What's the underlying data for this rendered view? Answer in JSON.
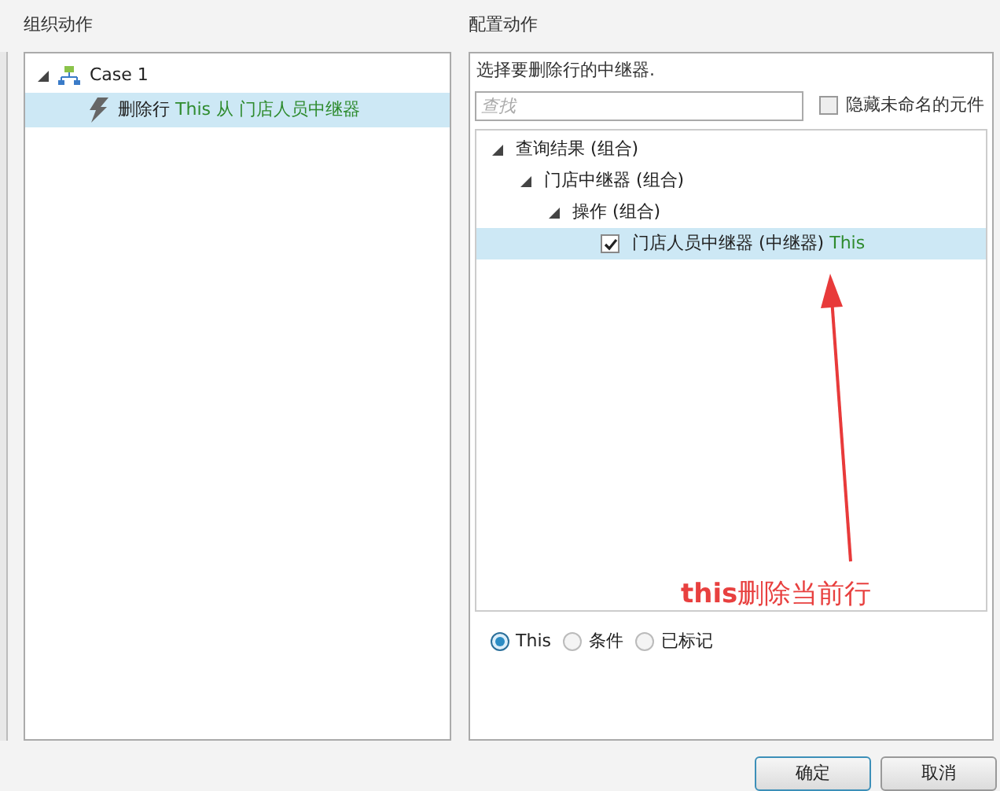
{
  "left_panel": {
    "title": "组织动作",
    "tree": [
      {
        "label": "Case 1",
        "kind": "case",
        "expanded": true,
        "selected": false,
        "children": [
          {
            "label": "删除行",
            "highlight": "This 从 门店人员中继器",
            "kind": "action",
            "selected": true
          }
        ]
      }
    ]
  },
  "right_panel": {
    "title": "配置动作",
    "instruction": "选择要删除行的中继器.",
    "search": {
      "placeholder": "查找"
    },
    "hide_unnamed": {
      "label": "隐藏未命名的元件",
      "checked": false
    },
    "tree": [
      {
        "label": "查询结果 (组合)",
        "expanded": true,
        "selected": false,
        "children": [
          {
            "label": "门店中继器 (组合)",
            "expanded": true,
            "selected": false,
            "children": [
              {
                "label": "操作 (组合)",
                "expanded": true,
                "selected": false,
                "children": [
                  {
                    "label": "门店人员中继器 (中继器)",
                    "highlight": "This",
                    "checked": true,
                    "selected": true
                  }
                ]
              }
            ]
          }
        ]
      }
    ],
    "annotation": "**this**删除当前行",
    "options": [
      {
        "label": "This",
        "selected": true
      },
      {
        "label": "条件",
        "selected": false
      },
      {
        "label": "已标记",
        "selected": false
      }
    ]
  },
  "buttons": [
    {
      "label": "确定",
      "kind": "primary"
    },
    {
      "label": "取消",
      "kind": "secondary"
    }
  ]
}
